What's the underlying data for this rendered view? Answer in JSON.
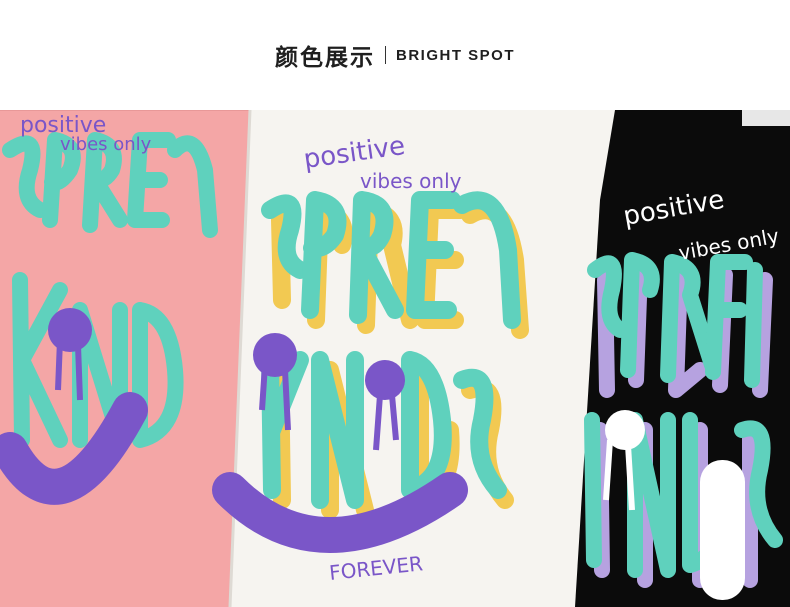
{
  "header": {
    "title_cn": "颜色展示",
    "title_en": "BRIGHT SPOT"
  },
  "photo": {
    "shirts": [
      {
        "name": "pink-shirt",
        "color": "#f4a6a6",
        "text": [
          "positive",
          "vibes only",
          "SPREAD",
          "KINDNESS"
        ]
      },
      {
        "name": "white-shirt",
        "color": "#f6f4f0",
        "text": [
          "positive",
          "vibes only",
          "SPREAD",
          "KINDNESS",
          "FOREVER"
        ]
      },
      {
        "name": "black-shirt",
        "color": "#0b0b0b",
        "text": [
          "positive",
          "vibes only",
          "SPREAD",
          "KINDNESS"
        ]
      }
    ],
    "colors": {
      "teal": "#5fd1bd",
      "purple": "#7a56c8",
      "yellow": "#f2c74a",
      "lavender": "#b6a2e0"
    }
  }
}
